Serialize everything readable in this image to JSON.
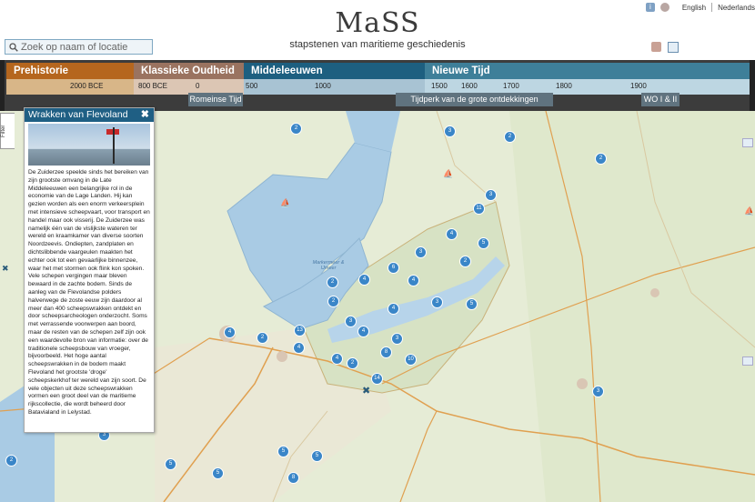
{
  "header": {
    "logo": "MaSS",
    "tagline": "stapstenen van maritieme geschiedenis",
    "lang_en": "English",
    "lang_nl": "Nederlands"
  },
  "search": {
    "placeholder": "Zoek op naam of locatie"
  },
  "timeline": {
    "eras": [
      "Prehistorie",
      "Klassieke Oudheid",
      "Middeleeuwen",
      "Nieuwe Tijd"
    ],
    "ticks": [
      "2000 BCE",
      "800 BCE",
      "0",
      "500",
      "1000",
      "1500",
      "1600",
      "1700",
      "1800",
      "1900"
    ],
    "periods": [
      "Romeinse Tijd",
      "Tijdperk van de grote ontdekkingen",
      "WO I & II"
    ]
  },
  "filter_tab": "Filter",
  "panel": {
    "title": "Wrakken van Flevoland",
    "close": "✖",
    "text": "De Zuiderzee speelde sinds het bereiken van zijn grootste omvang in de Late Middeleeuwen een belangrijke rol in de economie van de Lage Landen. Hij kan gezien worden als een enorm verkeersplein met intensieve scheepvaart, voor transport en handel maar ook visserij. De Zuiderzee was namelijk één van de vislijkste wateren ter wereld en kraamkamer van diverse soorten Noordzeevis. Ondiepten, zandplaten en dichtslibbende vaargeulen maakten het echter ook tot een gevaarlijke binnenzee, waar het met stormen ook flink kon spoken. Vele schepen vergingen maar bleven bewaard in de zachte bodem. Sinds de aanleg van de Flevolandse polders halverwege de zoste eeuw zijn daardoor al meer dan 400 scheepswrakken ontdekt en door scheepsarcheologen onderzocht. Soms met verrassende voorwerpen aan boord, maar de resten van de schepen zelf zijn ook een waardevolle bron van informatie: over de traditionele scheepsbouw van vroeger, bijvoorbeeld. Het hoge aantal scheepswrakken in de bodem maakt Flevoland het grootste 'droge' scheepskerkhof ter wereld van zijn soort. De vele objecten uit deze scheepswrakken vormen een groot deel van de maritieme rijkscollectie, die wordt beheerd door Batavialand in Lelystad."
  },
  "map": {
    "water_label": "Markermeer & IJmeer",
    "clusters": [
      "2",
      "3",
      "2",
      "2",
      "3",
      "11",
      "4",
      "5",
      "3",
      "2",
      "6",
      "4",
      "3",
      "5",
      "2",
      "4",
      "3",
      "4",
      "2",
      "13",
      "4",
      "3",
      "4",
      "8",
      "4",
      "2",
      "14",
      "10",
      "3",
      "3",
      "2",
      "5",
      "5",
      "5",
      "8",
      "5",
      "2",
      "4"
    ]
  },
  "colors": {
    "prehistorie": "#b5661e",
    "klassiek": "#9a7360",
    "middeleeuwen": "#1d5f80",
    "nieuwe_tijd": "#3e7f99",
    "cluster": "#3a86c8",
    "water": "#a9cbe4"
  }
}
